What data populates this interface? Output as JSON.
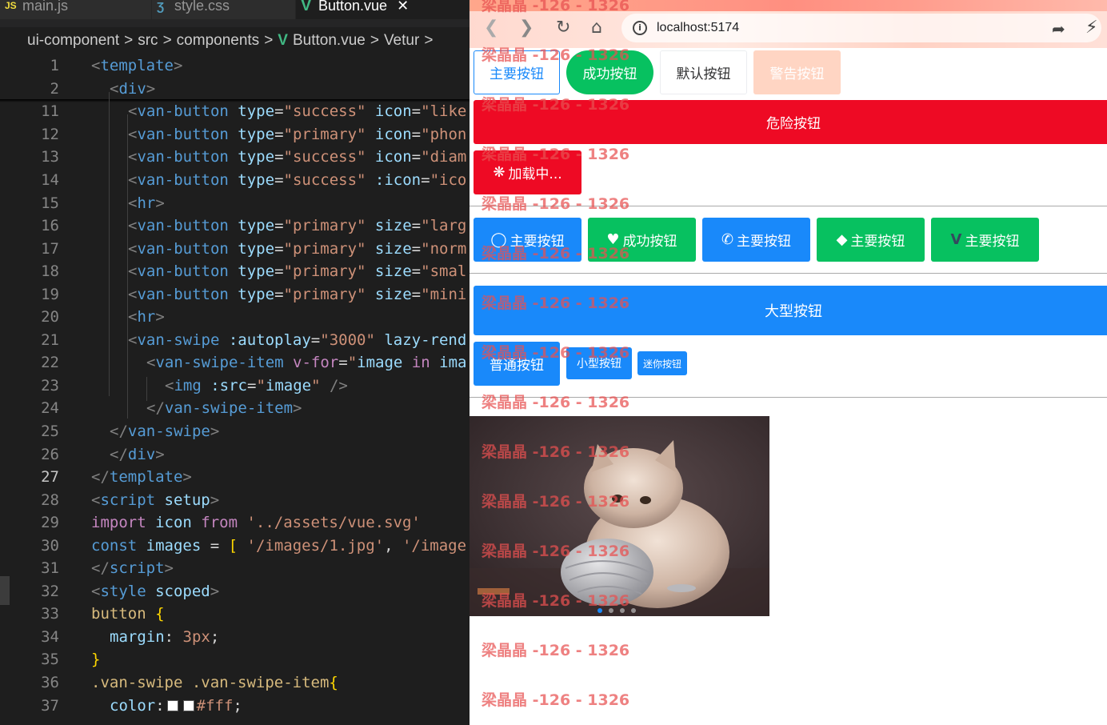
{
  "editor": {
    "tabs": [
      {
        "label": "main.js",
        "icon": "js-file-icon",
        "icon_text": "JS"
      },
      {
        "label": "style.css",
        "icon": "css-file-icon"
      },
      {
        "label": "Button.vue",
        "icon": "vue-file-icon",
        "close": "✕"
      }
    ],
    "breadcrumb": [
      "ui-component",
      "src",
      "components",
      "Button.vue",
      "Vetur"
    ],
    "breadcrumb_sep": ">",
    "lines": [
      {
        "n": "1",
        "tokens": [
          [
            "t",
            "<"
          ],
          [
            "tg",
            "template"
          ],
          [
            "t",
            ">"
          ]
        ],
        "indent": 0
      },
      {
        "n": "2",
        "tokens": [
          [
            "t",
            "<"
          ],
          [
            "tg",
            "div"
          ],
          [
            "t",
            ">"
          ]
        ],
        "indent": 1
      },
      {
        "n": "11",
        "tokens": [
          [
            "t",
            "<"
          ],
          [
            "tg",
            "van-button "
          ],
          [
            "at",
            "type"
          ],
          [
            "pl",
            "="
          ],
          [
            "st",
            "\"success\" "
          ],
          [
            "at",
            "icon"
          ],
          [
            "pl",
            "="
          ],
          [
            "st",
            "\"like"
          ]
        ],
        "indent": 2
      },
      {
        "n": "12",
        "tokens": [
          [
            "t",
            "<"
          ],
          [
            "tg",
            "van-button "
          ],
          [
            "at",
            "type"
          ],
          [
            "pl",
            "="
          ],
          [
            "st",
            "\"primary\" "
          ],
          [
            "at",
            "icon"
          ],
          [
            "pl",
            "="
          ],
          [
            "st",
            "\"phon"
          ]
        ],
        "indent": 2
      },
      {
        "n": "13",
        "tokens": [
          [
            "t",
            "<"
          ],
          [
            "tg",
            "van-button "
          ],
          [
            "at",
            "type"
          ],
          [
            "pl",
            "="
          ],
          [
            "st",
            "\"success\" "
          ],
          [
            "at",
            "icon"
          ],
          [
            "pl",
            "="
          ],
          [
            "st",
            "\"diam"
          ]
        ],
        "indent": 2
      },
      {
        "n": "14",
        "tokens": [
          [
            "t",
            "<"
          ],
          [
            "tg",
            "van-button "
          ],
          [
            "at",
            "type"
          ],
          [
            "pl",
            "="
          ],
          [
            "st",
            "\"success\" "
          ],
          [
            "at",
            ":icon"
          ],
          [
            "pl",
            "="
          ],
          [
            "st",
            "\"ico"
          ]
        ],
        "indent": 2
      },
      {
        "n": "15",
        "tokens": [
          [
            "t",
            "<"
          ],
          [
            "tg",
            "hr"
          ],
          [
            "t",
            ">"
          ]
        ],
        "indent": 2
      },
      {
        "n": "16",
        "tokens": [
          [
            "t",
            "<"
          ],
          [
            "tg",
            "van-button "
          ],
          [
            "at",
            "type"
          ],
          [
            "pl",
            "="
          ],
          [
            "st",
            "\"primary\" "
          ],
          [
            "at",
            "size"
          ],
          [
            "pl",
            "="
          ],
          [
            "st",
            "\"larg"
          ]
        ],
        "indent": 2
      },
      {
        "n": "17",
        "tokens": [
          [
            "t",
            "<"
          ],
          [
            "tg",
            "van-button "
          ],
          [
            "at",
            "type"
          ],
          [
            "pl",
            "="
          ],
          [
            "st",
            "\"primary\" "
          ],
          [
            "at",
            "size"
          ],
          [
            "pl",
            "="
          ],
          [
            "st",
            "\"norm"
          ]
        ],
        "indent": 2
      },
      {
        "n": "18",
        "tokens": [
          [
            "t",
            "<"
          ],
          [
            "tg",
            "van-button "
          ],
          [
            "at",
            "type"
          ],
          [
            "pl",
            "="
          ],
          [
            "st",
            "\"primary\" "
          ],
          [
            "at",
            "size"
          ],
          [
            "pl",
            "="
          ],
          [
            "st",
            "\"smal"
          ]
        ],
        "indent": 2
      },
      {
        "n": "19",
        "tokens": [
          [
            "t",
            "<"
          ],
          [
            "tg",
            "van-button "
          ],
          [
            "at",
            "type"
          ],
          [
            "pl",
            "="
          ],
          [
            "st",
            "\"primary\" "
          ],
          [
            "at",
            "size"
          ],
          [
            "pl",
            "="
          ],
          [
            "st",
            "\"mini"
          ]
        ],
        "indent": 2
      },
      {
        "n": "20",
        "tokens": [
          [
            "t",
            "<"
          ],
          [
            "tg",
            "hr"
          ],
          [
            "t",
            ">"
          ]
        ],
        "indent": 2
      },
      {
        "n": "21",
        "tokens": [
          [
            "t",
            "<"
          ],
          [
            "tg",
            "van-swipe "
          ],
          [
            "at",
            ":autoplay"
          ],
          [
            "pl",
            "="
          ],
          [
            "st",
            "\"3000\" "
          ],
          [
            "at",
            "lazy-rend"
          ]
        ],
        "indent": 2
      },
      {
        "n": "22",
        "tokens": [
          [
            "t",
            "<"
          ],
          [
            "tg",
            "van-swipe-item "
          ],
          [
            "kw",
            "v-for"
          ],
          [
            "pl",
            "="
          ],
          [
            "st",
            "\""
          ],
          [
            "id",
            "image "
          ],
          [
            "kw",
            "in "
          ],
          [
            "id",
            "ima"
          ]
        ],
        "indent": 3
      },
      {
        "n": "23",
        "tokens": [
          [
            "t",
            "<"
          ],
          [
            "tg",
            "img "
          ],
          [
            "at",
            ":src"
          ],
          [
            "pl",
            "="
          ],
          [
            "st",
            "\""
          ],
          [
            "id",
            "image"
          ],
          [
            "st",
            "\" "
          ],
          [
            "t",
            "/>"
          ]
        ],
        "indent": 4
      },
      {
        "n": "24",
        "tokens": [
          [
            "t",
            "</"
          ],
          [
            "tg",
            "van-swipe-item"
          ],
          [
            "t",
            ">"
          ]
        ],
        "indent": 3
      },
      {
        "n": "25",
        "tokens": [
          [
            "t",
            "</"
          ],
          [
            "tg",
            "van-swipe"
          ],
          [
            "t",
            ">"
          ]
        ],
        "indent": 1
      },
      {
        "n": "26",
        "tokens": [
          [
            "t",
            "</"
          ],
          [
            "tg",
            "div"
          ],
          [
            "t",
            ">"
          ]
        ],
        "indent": 1
      },
      {
        "n": "27",
        "tokens": [
          [
            "t",
            "</"
          ],
          [
            "tg",
            "template"
          ],
          [
            "t",
            ">"
          ]
        ],
        "indent": 0
      },
      {
        "n": "28",
        "tokens": [
          [
            "t",
            "<"
          ],
          [
            "tg",
            "script "
          ],
          [
            "at",
            "setup"
          ],
          [
            "t",
            ">"
          ]
        ],
        "indent": 0
      },
      {
        "n": "29",
        "tokens": [
          [
            "kw",
            "import "
          ],
          [
            "id",
            "icon "
          ],
          [
            "kw",
            "from "
          ],
          [
            "st",
            "'../assets/vue.svg'"
          ]
        ],
        "indent": 0
      },
      {
        "n": "30",
        "tokens": [
          [
            "tg",
            "const "
          ],
          [
            "id",
            "images "
          ],
          [
            "pl",
            "= "
          ],
          [
            "br",
            "[ "
          ],
          [
            "st",
            "'/images/1.jpg'"
          ],
          [
            "pl",
            ", "
          ],
          [
            "st",
            "'/image"
          ]
        ],
        "indent": 0
      },
      {
        "n": "31",
        "tokens": [
          [
            "t",
            "</"
          ],
          [
            "tg",
            "script"
          ],
          [
            "t",
            ">"
          ]
        ],
        "indent": 0
      },
      {
        "n": "32",
        "tokens": [
          [
            "t",
            "<"
          ],
          [
            "tg",
            "style "
          ],
          [
            "at",
            "scoped"
          ],
          [
            "t",
            ">"
          ]
        ],
        "indent": 0
      },
      {
        "n": "33",
        "tokens": [
          [
            "sel",
            "button "
          ],
          [
            "br",
            "{"
          ]
        ],
        "indent": 0
      },
      {
        "n": "34",
        "tokens": [
          [
            "at",
            "margin"
          ],
          [
            "pl",
            ": "
          ],
          [
            "st",
            "3px"
          ],
          [
            "pl",
            ";"
          ]
        ],
        "indent": 1
      },
      {
        "n": "35",
        "tokens": [
          [
            "br",
            "}"
          ]
        ],
        "indent": 0
      },
      {
        "n": "36",
        "tokens": [
          [
            "sel",
            ".van-swipe .van-swipe-item"
          ],
          [
            "br",
            "{"
          ]
        ],
        "indent": 0
      },
      {
        "n": "37",
        "tokens": [
          [
            "at",
            "color"
          ],
          [
            "pl",
            ":"
          ],
          [
            "sq",
            ""
          ],
          [
            "sq",
            ""
          ],
          [
            "st",
            "#fff"
          ],
          [
            "pl",
            ";"
          ]
        ],
        "indent": 1
      }
    ]
  },
  "browser": {
    "url": "localhost:5174",
    "info_glyph": "i",
    "row1": [
      {
        "label": "主要按钮",
        "variant": "plain-primary"
      },
      {
        "label": "成功按钮",
        "variant": "round-success"
      },
      {
        "label": "默认按钮",
        "variant": "default"
      },
      {
        "label": "警告按钮",
        "variant": "disabled-warning"
      }
    ],
    "danger_block": "危险按钮",
    "loading": "加载中...",
    "icon_buttons": [
      {
        "label": "主要按钮",
        "icon": "circle-icon",
        "color": "#1989fa"
      },
      {
        "label": "成功按钮",
        "icon": "heart-icon",
        "color": "#07c160"
      },
      {
        "label": "主要按钮",
        "icon": "phone-icon",
        "color": "#1989fa"
      },
      {
        "label": "主要按钮",
        "icon": "diamond-icon",
        "color": "#07c160"
      },
      {
        "label": "主要按钮",
        "icon": "vue-logo-icon",
        "color": "#07c160"
      }
    ],
    "large_button": "大型按钮",
    "normal_button": "普通按钮",
    "small_button": "小型按钮",
    "mini_button": "迷你按钮",
    "watermark": "梁晶晶 -126 - 1326",
    "swipe_dots": 4
  },
  "colors": {
    "primary": "#1989fa",
    "success": "#07c160",
    "danger": "#ee0a24",
    "warning": "#ff976a"
  }
}
